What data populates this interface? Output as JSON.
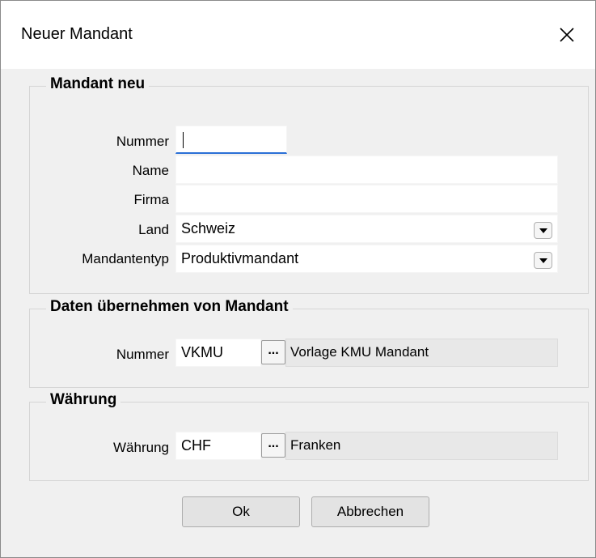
{
  "window": {
    "title": "Neuer Mandant"
  },
  "mandant_neu": {
    "legend": "Mandant neu",
    "nummer_label": "Nummer",
    "nummer_value": "",
    "name_label": "Name",
    "name_value": "",
    "firma_label": "Firma",
    "firma_value": "",
    "land_label": "Land",
    "land_value": "Schweiz",
    "typ_label": "Mandantentyp",
    "typ_value": "Produktivmandant"
  },
  "daten": {
    "legend": "Daten übernehmen von Mandant",
    "nummer_label": "Nummer",
    "nummer_value": "VKMU",
    "lookup_label": "...",
    "description": "Vorlage KMU Mandant"
  },
  "waehrung": {
    "legend": "Währung",
    "label": "Währung",
    "value": "CHF",
    "lookup_label": "...",
    "description": "Franken"
  },
  "buttons": {
    "ok": "Ok",
    "cancel": "Abbrechen"
  },
  "icons": {
    "close": "close-icon",
    "dropdown": "chevron-down-icon"
  }
}
